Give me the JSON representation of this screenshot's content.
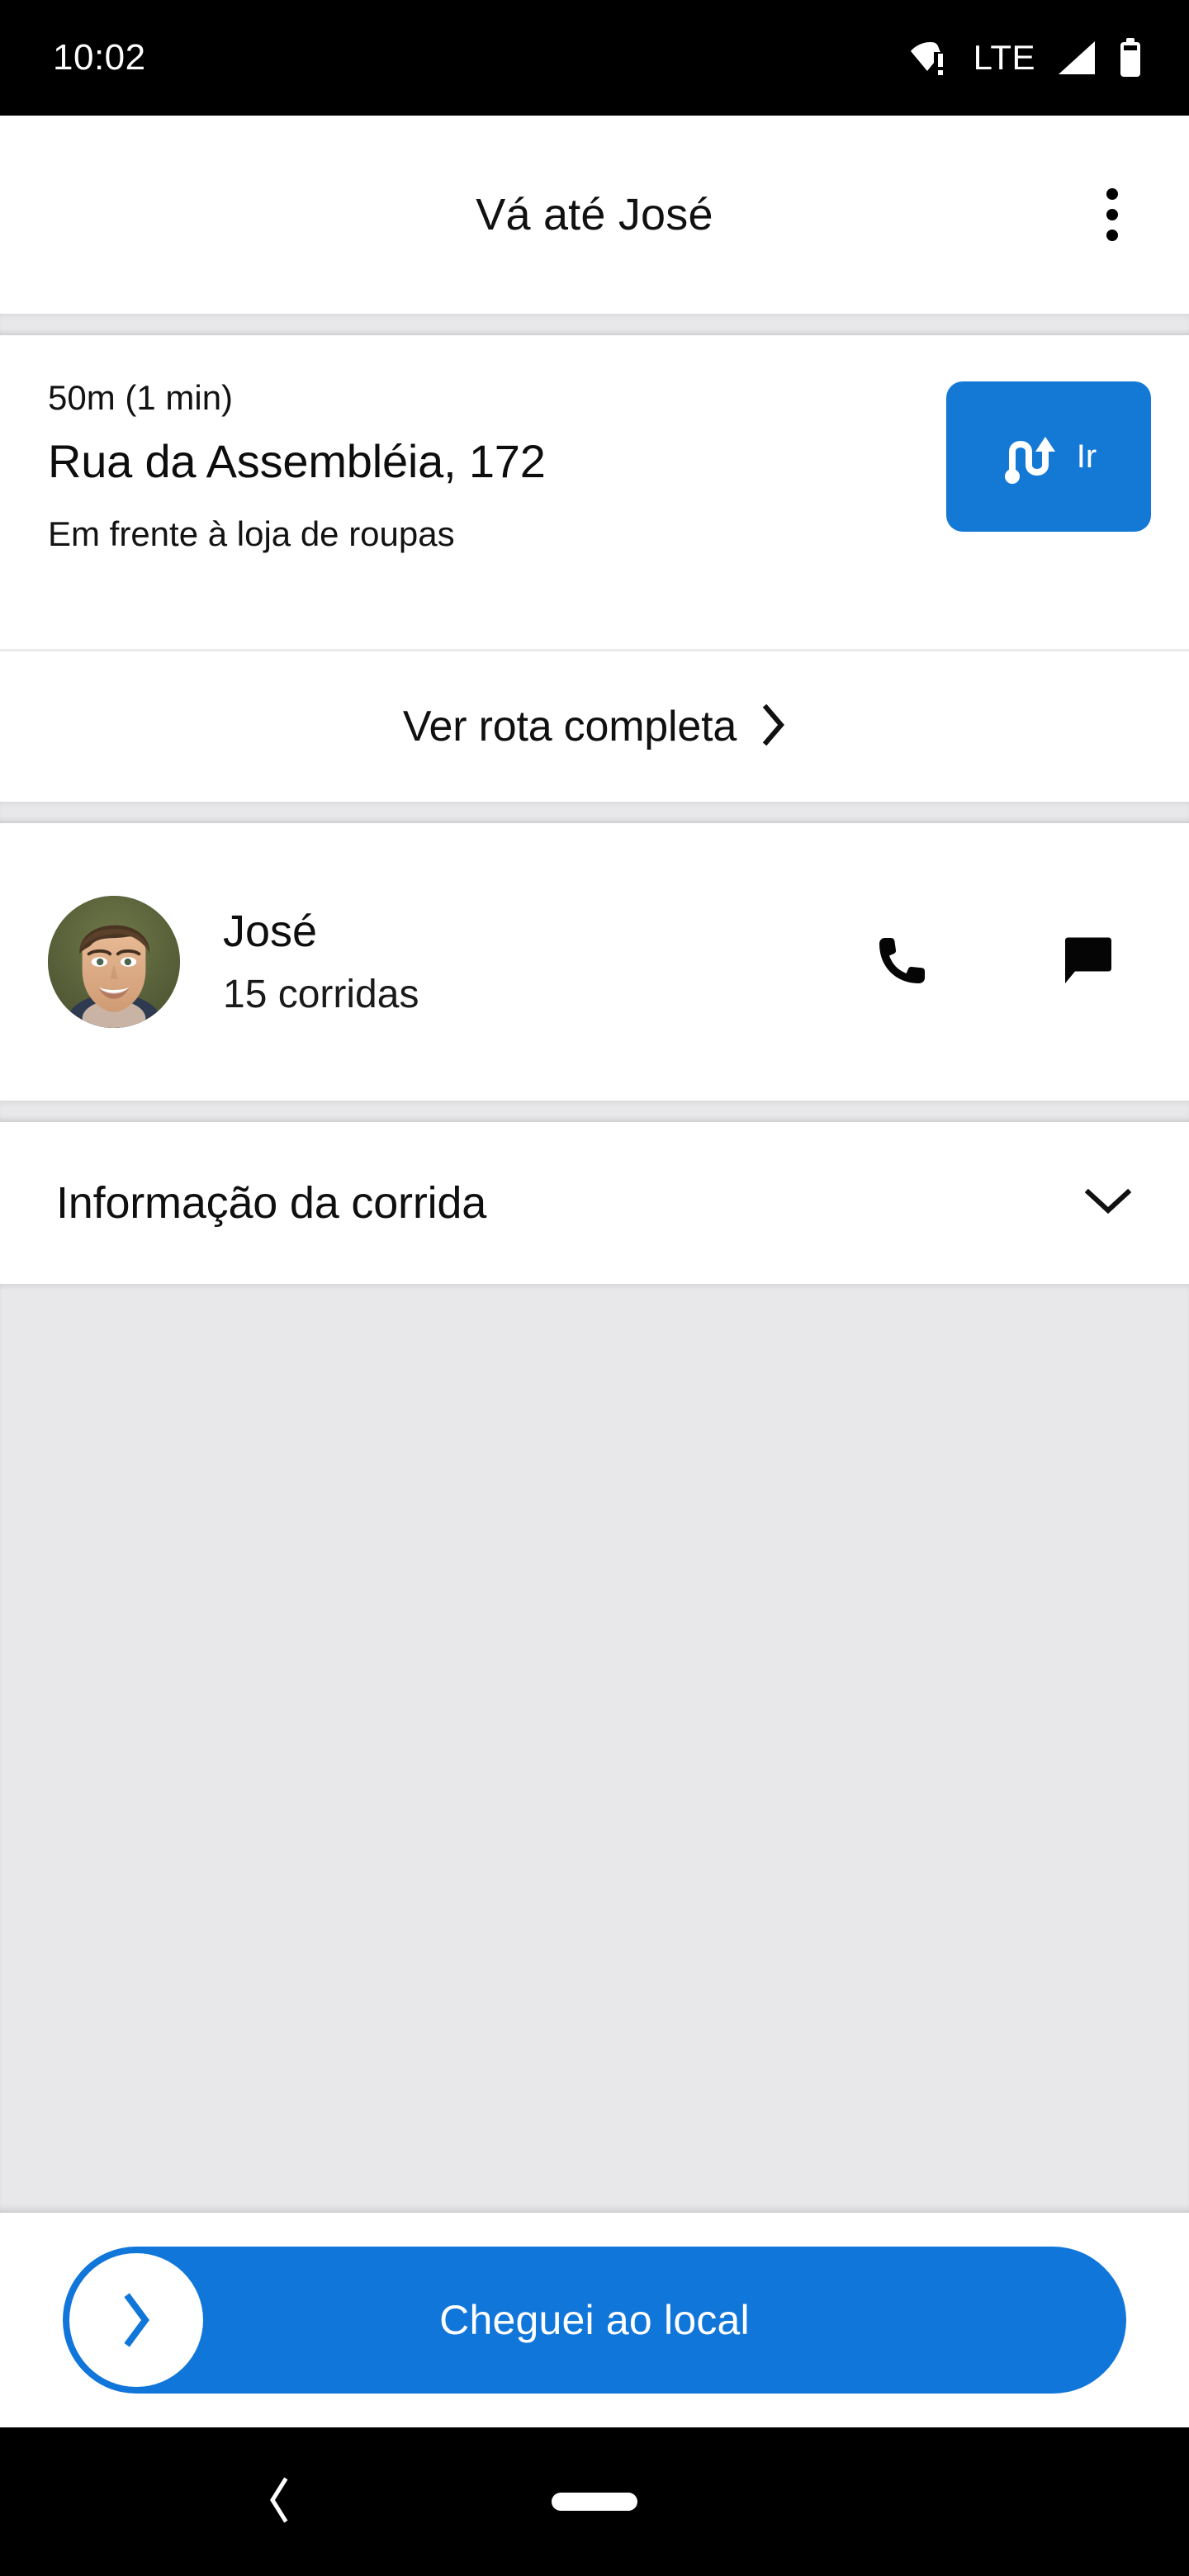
{
  "status_bar": {
    "time": "10:02",
    "icons": [
      "wifi-alert-icon",
      "lte-label",
      "cellular-signal-icon",
      "battery-icon"
    ],
    "network_label": "LTE"
  },
  "app_bar": {
    "title": "Vá até José",
    "overflow_menu": "more-options"
  },
  "address_card": {
    "eta": "50m (1 min)",
    "street": "Rua da Assembléia, 172",
    "landmark": "Em frente à loja de roupas",
    "go_button": {
      "label": "Ir",
      "icon": "navigation-route-icon",
      "color": "#1479d4"
    }
  },
  "route_row": {
    "label": "Ver rota completa",
    "icon": "chevron-right-icon"
  },
  "person_card": {
    "name": "José",
    "rides": "15 corridas",
    "avatar": "passenger-photo",
    "actions": [
      {
        "name": "call",
        "icon": "phone-icon"
      },
      {
        "name": "message",
        "icon": "chat-bubble-icon"
      }
    ]
  },
  "ride_info": {
    "label": "Informação da corrida",
    "icon": "chevron-down-icon",
    "expanded": false
  },
  "bottom_action": {
    "label": "Cheguei ao local",
    "handle_icon": "chevron-right-icon",
    "color": "#1176d9"
  },
  "nav_bar": {
    "back": "back-icon",
    "home": "home-pill"
  },
  "colors": {
    "accent": "#1176d9",
    "go_button": "#1479d4",
    "surface": "#ffffff",
    "background": "#e8e7ea",
    "status_bar": "#000000",
    "text_primary": "#101010"
  }
}
